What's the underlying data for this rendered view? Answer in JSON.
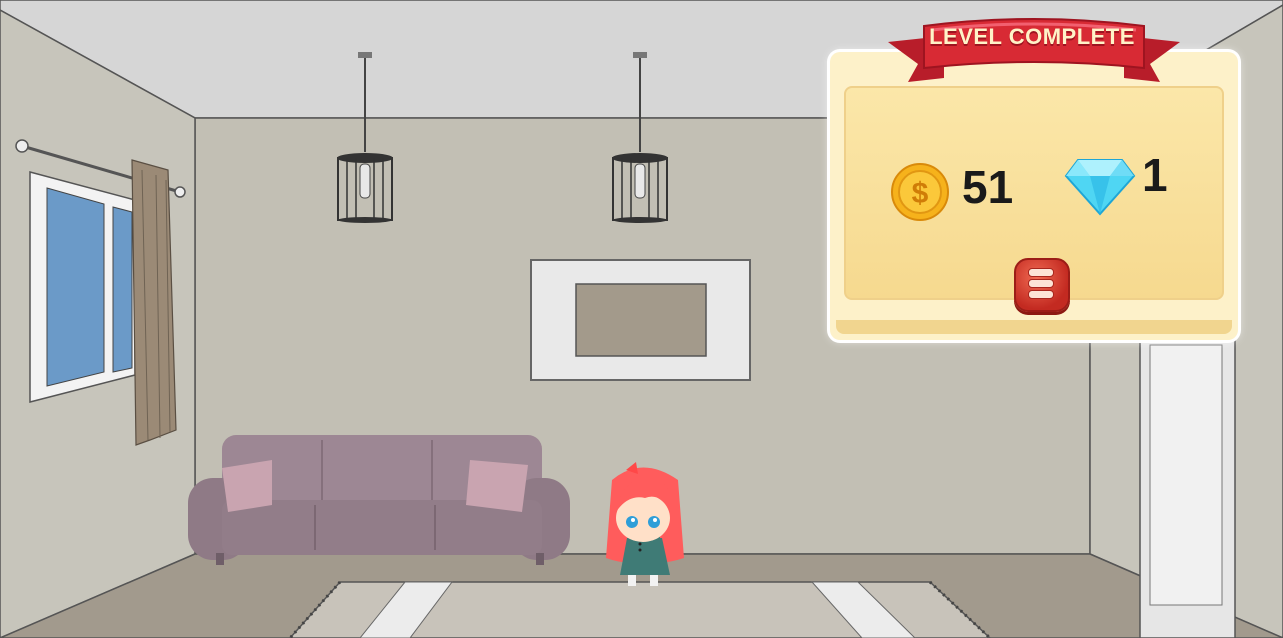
{
  "level_complete": {
    "title": "LEVEL COMPLETE",
    "coins": {
      "value": "51",
      "icon": "gold-coin-icon",
      "symbol": "$"
    },
    "gems": {
      "value": "1",
      "icon": "blue-diamond-icon"
    },
    "menu_button": {
      "icon": "hamburger-menu-icon"
    }
  },
  "colors": {
    "ribbon": "#d82a34",
    "panel": "#fbe7a9",
    "coin": "#f6b21b",
    "diamond": "#4fd6f3",
    "menu_button": "#d8382b",
    "wall": "#c2bfb4",
    "sofa": "#9b8592",
    "character_hair": "#ff5a5a"
  }
}
